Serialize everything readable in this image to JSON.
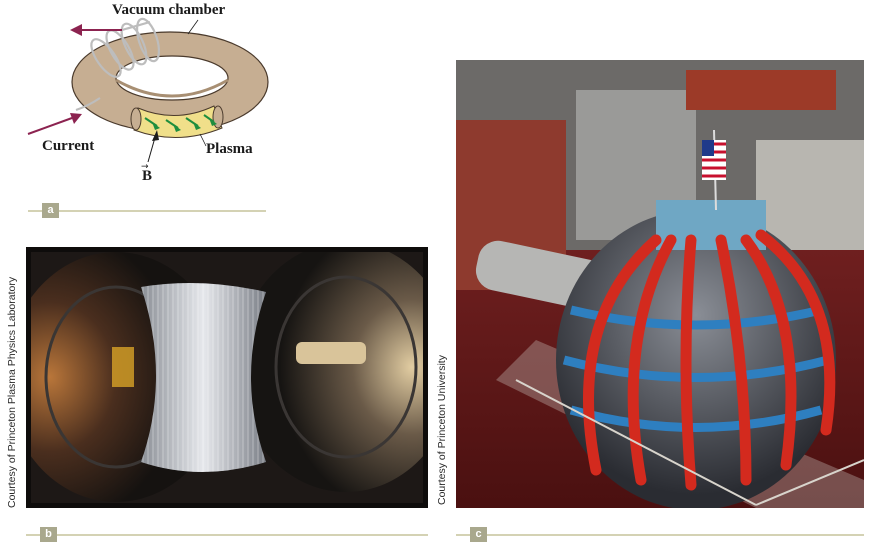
{
  "panel_a": {
    "labels": {
      "vacuum_chamber": "Vacuum chamber",
      "current": "Current",
      "plasma": "Plasma",
      "field": "B"
    },
    "tag": "a"
  },
  "panel_b": {
    "tag": "b",
    "credit": "Courtesy of Princeton Plasma Physics Laboratory"
  },
  "panel_c": {
    "tag": "c",
    "credit": "Courtesy of Princeton University"
  },
  "colors": {
    "rule": "#d4d2b4",
    "tag_bg": "#a9a88d",
    "arrow_current": "#8c2350",
    "arrow_field": "#1e8e3e",
    "torus": "#c6ae92",
    "plasma": "#f0df8a"
  }
}
